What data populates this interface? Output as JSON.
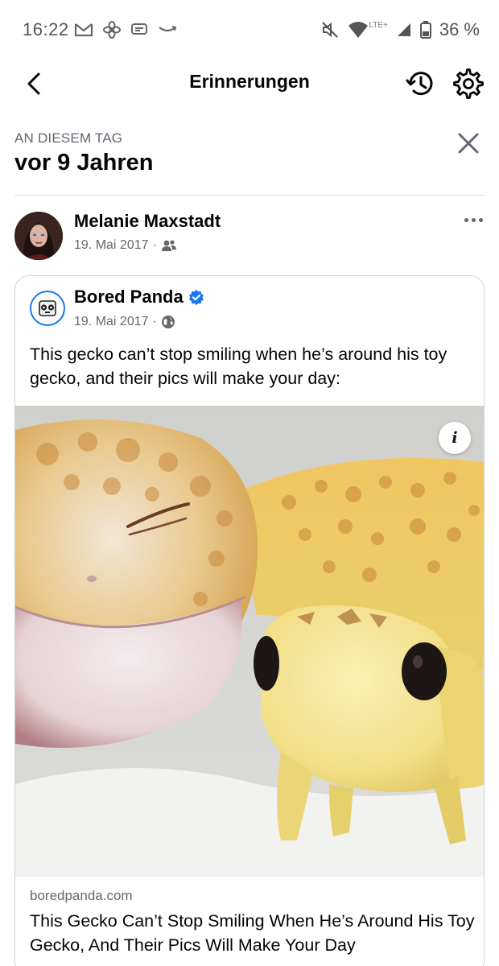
{
  "status_bar": {
    "time": "16:22",
    "network": "LTE+",
    "battery": "36 %",
    "icons": [
      "gmail-icon",
      "fan-icon",
      "message-icon",
      "amazon-icon",
      "mute-icon",
      "wifi-icon",
      "signal-icon",
      "battery-icon"
    ]
  },
  "header": {
    "title": "Erinnerungen",
    "icons": [
      "back-arrow-icon",
      "history-icon",
      "gear-icon"
    ]
  },
  "memories": {
    "label": "AN DIESEM TAG",
    "heading": "vor 9 Jahren"
  },
  "post": {
    "author": "Melanie Maxstadt",
    "date": "19. Mai 2017",
    "separator": "·",
    "audience_icon": "friends-icon"
  },
  "shared_post": {
    "page_name": "Bored Panda",
    "verified": true,
    "date": "19. Mai 2017",
    "separator": "·",
    "audience_icon": "globe-icon",
    "text": "This gecko can’t stop smiling when he’s around his toy gecko, and their pics will make your day:",
    "info_label": "i",
    "link_domain": "boredpanda.com",
    "link_title": "This Gecko Can’t Stop Smiling When He’s Around His Toy Gecko, And Their Pics Will Make Your Day"
  },
  "colors": {
    "accent": "#1877f2",
    "text": "#050505",
    "secondary_text": "#65676b",
    "divider": "#dadde1"
  }
}
